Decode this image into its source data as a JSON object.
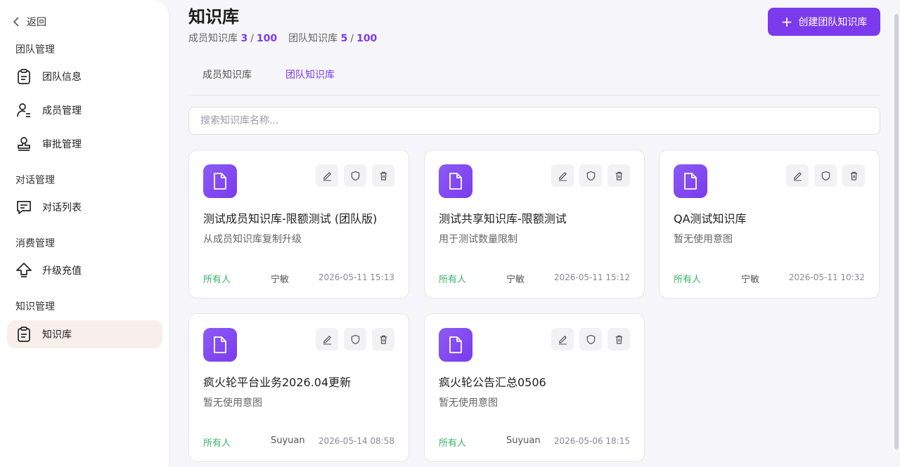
{
  "sidebar": {
    "back_label": "返回",
    "groups": [
      {
        "title": "团队管理",
        "items": [
          {
            "label": "团队信息",
            "icon": "clipboard-icon"
          },
          {
            "label": "成员管理",
            "icon": "user-list-icon"
          },
          {
            "label": "审批管理",
            "icon": "stamp-icon"
          }
        ]
      },
      {
        "title": "对话管理",
        "items": [
          {
            "label": "对话列表",
            "icon": "chat-icon"
          }
        ]
      },
      {
        "title": "消费管理",
        "items": [
          {
            "label": "升级充值",
            "icon": "upgrade-icon"
          }
        ]
      },
      {
        "title": "知识管理",
        "items": [
          {
            "label": "知识库",
            "icon": "clipboard-icon",
            "active": true
          }
        ]
      }
    ]
  },
  "header": {
    "title": "知识库",
    "quota_member_label": "成员知识库",
    "quota_member_used": "3",
    "quota_member_total": "100",
    "quota_team_label": "团队知识库",
    "quota_team_used": "5",
    "quota_team_total": "100",
    "quota_sep": "/",
    "create_button": "创建团队知识库"
  },
  "tabs": [
    {
      "label": "成员知识库",
      "active": false
    },
    {
      "label": "团队知识库",
      "active": true
    }
  ],
  "search": {
    "placeholder": "搜索知识库名称..."
  },
  "cards": [
    {
      "name": "测试成员知识库-限额测试 (团队版)",
      "desc": "从成员知识库复制升级",
      "perm": "所有人",
      "owner": "宁敏",
      "time": "2026-05-11 15:13"
    },
    {
      "name": "测试共享知识库-限额测试",
      "desc": "用于测试数量限制",
      "perm": "所有人",
      "owner": "宁敏",
      "time": "2026-05-11 15:12"
    },
    {
      "name": "QA测试知识库",
      "desc": "暂无使用意图",
      "perm": "所有人",
      "owner": "宁敏",
      "time": "2026-05-11 10:32"
    },
    {
      "name": "疯火轮平台业务2026.04更新",
      "desc": "暂无使用意图",
      "perm": "所有人",
      "owner": "Suyuan",
      "time": "2026-05-14 08:58"
    },
    {
      "name": "疯火轮公告汇总0506",
      "desc": "暂无使用意图",
      "perm": "所有人",
      "owner": "Suyuan",
      "time": "2026-05-06 18:15"
    }
  ],
  "colors": {
    "accent": "#7c3aed",
    "perm_green": "#38b26a",
    "active_nav_bg": "#f8efec"
  }
}
